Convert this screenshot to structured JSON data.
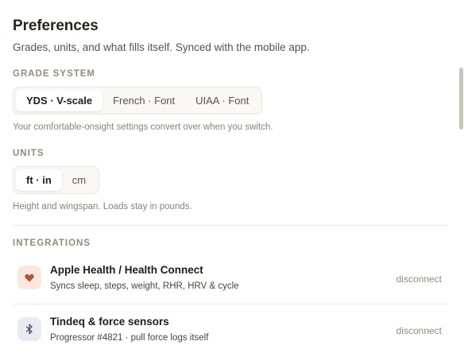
{
  "header": {
    "title": "Preferences",
    "subtitle": "Grades, units, and what fills itself. Synced with the mobile app."
  },
  "grade_system": {
    "label": "GRADE SYSTEM",
    "options": [
      {
        "label": "YDS · V-scale",
        "selected": true
      },
      {
        "label": "French · Font",
        "selected": false
      },
      {
        "label": "UIAA · Font",
        "selected": false
      }
    ],
    "hint": "Your comfortable-onsight settings convert over when you switch."
  },
  "units": {
    "label": "UNITS",
    "options": [
      {
        "label": "ft · in",
        "selected": true
      },
      {
        "label": "cm",
        "selected": false
      }
    ],
    "hint": "Height and wingspan. Loads stay in pounds."
  },
  "integrations": {
    "label": "INTEGRATIONS",
    "items": [
      {
        "name": "Apple Health / Health Connect",
        "description": "Syncs sleep, steps, weight, RHR, HRV & cycle",
        "action": "disconnect",
        "icon": "heart-icon",
        "icon_bg": "#fbe7de",
        "icon_color": "#b4543a"
      },
      {
        "name": "Tindeq & force sensors",
        "description": "Progressor #4821 · pull force logs itself",
        "action": "disconnect",
        "icon": "bluetooth-icon",
        "icon_bg": "#e8ebf1",
        "icon_color": "#4c5566"
      }
    ]
  }
}
